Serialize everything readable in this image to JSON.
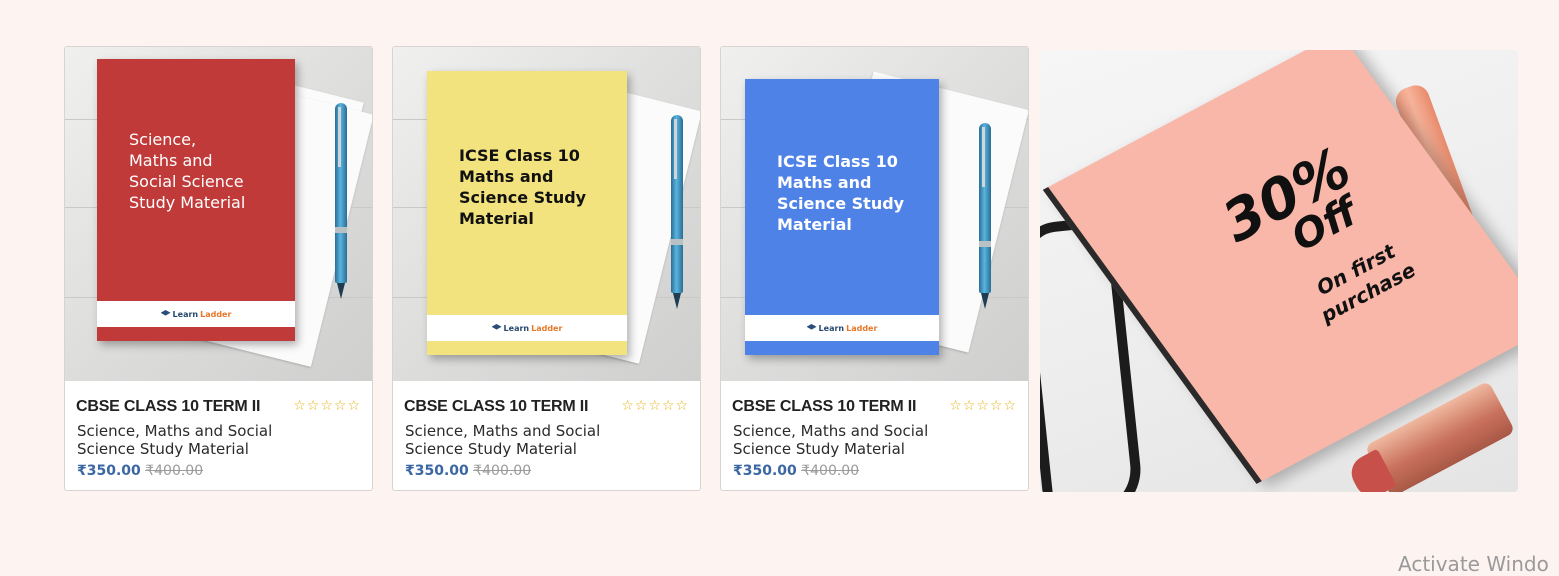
{
  "products": [
    {
      "cover_title": "Science,\nMaths and\nSocial Science\nStudy Material",
      "cover_color": "#c13a3a",
      "cover_text_color": "#ffffff",
      "logo": {
        "a": "Learn",
        "b": "Ladder"
      },
      "name": "CBSE CLASS 10 TERM II",
      "rating_stars": "☆☆☆☆☆",
      "description": "Science, Maths and Social Science Study Material",
      "price_now": "₹350.00",
      "price_old": "₹400.00"
    },
    {
      "cover_title": "ICSE Class 10\nMaths and\nScience Study\nMaterial",
      "cover_color": "#f2e37e",
      "cover_text_color": "#111111",
      "logo": {
        "a": "Learn",
        "b": "Ladder"
      },
      "name": "CBSE CLASS 10 TERM II",
      "rating_stars": "☆☆☆☆☆",
      "description": "Science, Maths and Social Science Study Material",
      "price_now": "₹350.00",
      "price_old": "₹400.00"
    },
    {
      "cover_title": "ICSE Class 10\nMaths and\nScience Study\nMaterial",
      "cover_color": "#4e82e6",
      "cover_text_color": "#ffffff",
      "logo": {
        "a": "Learn",
        "b": "Ladder"
      },
      "name": "CBSE CLASS 10 TERM II",
      "rating_stars": "☆☆☆☆☆",
      "description": "Science, Maths and Social Science Study Material",
      "price_now": "₹350.00",
      "price_old": "₹400.00"
    }
  ],
  "banner": {
    "percent": "30%",
    "off": "Off",
    "subtitle": "On first purchase"
  },
  "watermark": "Activate Windo"
}
